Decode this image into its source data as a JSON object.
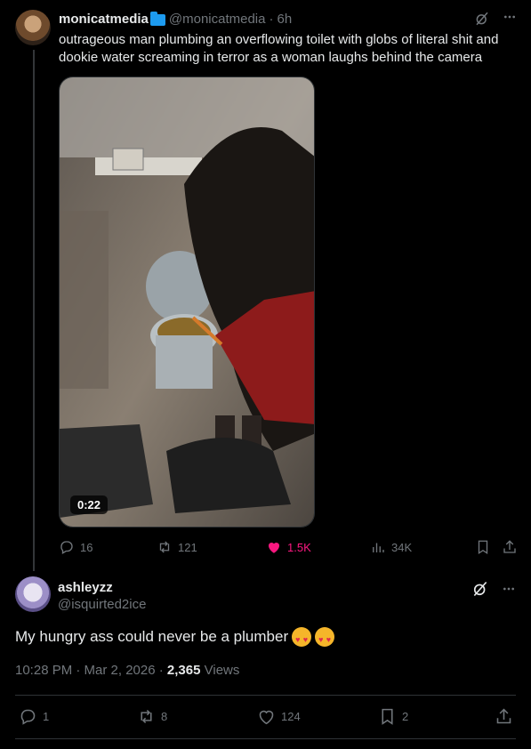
{
  "post": {
    "author_name": "monicatmedia",
    "author_handle": "@monicatmedia",
    "separator": "·",
    "time": "6h",
    "text": "outrageous man plumbing an overflowing toilet with globs of literal shit and dookie water screaming in terror as a woman laughs behind the camera",
    "video_duration": "0:22",
    "replies": "16",
    "reposts": "121",
    "likes": "1.5K",
    "views": "34K",
    "liked": true
  },
  "reply": {
    "author_name": "ashleyzz",
    "author_handle": "@isquirted2ice",
    "text": "My hungry ass could never be a plumber",
    "timestamp": "10:28 PM · Mar 2, 2026 · ",
    "views_count": "2,365",
    "views_label": " Views",
    "replies": "1",
    "reposts": "8",
    "likes": "124",
    "bookmarks": "2"
  },
  "icons": {
    "grok": "grok-icon",
    "more": "more-icon",
    "reply": "reply-icon",
    "repost": "repost-icon",
    "like": "heart-icon",
    "views": "views-icon",
    "bookmark": "bookmark-icon",
    "share": "share-icon"
  },
  "colors": {
    "background": "#000000",
    "text": "#e7e9ea",
    "muted": "#71767b",
    "like": "#f91880",
    "badge": "#1d9bf0"
  }
}
